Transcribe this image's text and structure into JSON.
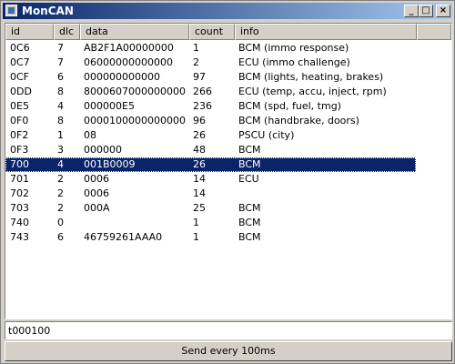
{
  "window": {
    "title": "MonCAN"
  },
  "caption": {
    "minimize": "_",
    "maximize": "□",
    "close": "×"
  },
  "table": {
    "headers": [
      "id",
      "dlc",
      "data",
      "count",
      "info"
    ],
    "rows": [
      [
        "0C6",
        "7",
        "AB2F1A00000000",
        "1",
        "BCM (immo response)"
      ],
      [
        "0C7",
        "7",
        "06000000000000",
        "2",
        "ECU (immo challenge)"
      ],
      [
        "0CF",
        "6",
        "000000000000",
        "97",
        "BCM (lights, heating, brakes)"
      ],
      [
        "0DD",
        "8",
        "8000607000000000",
        "266",
        "ECU (temp, accu, inject, rpm)"
      ],
      [
        "0E5",
        "4",
        "000000E5",
        "236",
        "BCM (spd, fuel, tmg)"
      ],
      [
        "0F0",
        "8",
        "0000100000000000",
        "96",
        "BCM (handbrake, doors)"
      ],
      [
        "0F2",
        "1",
        "08",
        "26",
        "PSCU (city)"
      ],
      [
        "0F3",
        "3",
        "000000",
        "48",
        "BCM"
      ],
      [
        "700",
        "4",
        "001B0009",
        "26",
        "BCM"
      ],
      [
        "701",
        "2",
        "0006",
        "14",
        "ECU"
      ],
      [
        "702",
        "2",
        "0006",
        "14",
        ""
      ],
      [
        "703",
        "2",
        "000A",
        "25",
        "BCM"
      ],
      [
        "740",
        "0",
        "",
        "1",
        "BCM"
      ],
      [
        "743",
        "6",
        "46759261AAA0",
        "1",
        "BCM"
      ]
    ],
    "selected_row": 8
  },
  "input": {
    "value": "t000100"
  },
  "send_button": {
    "label": "Send every 100ms"
  }
}
